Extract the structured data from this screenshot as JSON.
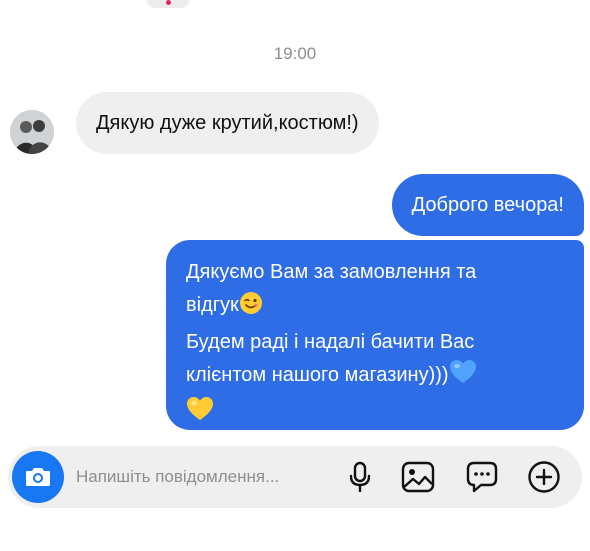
{
  "chat": {
    "timestamp": "19:00",
    "incoming": {
      "text": "Дякую дуже крутий,костюм!)"
    },
    "outgoing": {
      "greeting": "Доброго вечора!",
      "lines": [
        "Дякуємо Вам за замовлення та",
        "відгук",
        "Будем раді і надалі бачити Вас",
        "клієнтом нашого магазину)))"
      ],
      "emojis": [
        "winking-face",
        "blue-heart",
        "yellow-heart"
      ]
    }
  },
  "composer": {
    "placeholder": "Напишіть повідомлення...",
    "icons": [
      "camera-icon",
      "microphone-icon",
      "image-icon",
      "sticker-icon",
      "plus-icon"
    ]
  },
  "colors": {
    "outgoing_bubble": "#2f6de6",
    "incoming_bubble": "#efefef",
    "camera_button": "#1877f2",
    "timestamp_text": "#8e8e93"
  }
}
